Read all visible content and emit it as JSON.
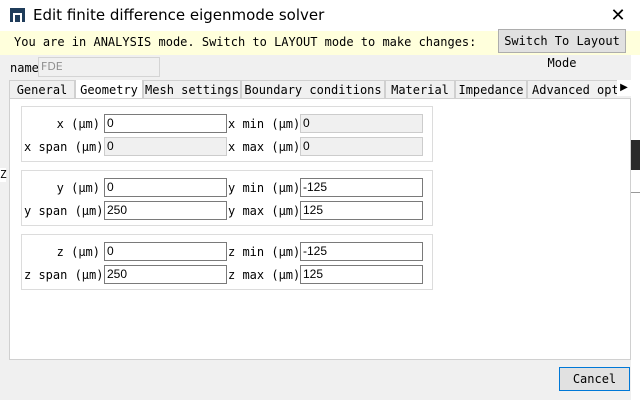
{
  "window": {
    "title": "Edit finite difference eigenmode solver",
    "close_glyph": "✕"
  },
  "banner": {
    "text": "You are in ANALYSIS mode.  Switch to LAYOUT mode to make changes:",
    "button_label": "Switch To Layout Mode"
  },
  "name": {
    "label": "name",
    "value": "FDE"
  },
  "tabs": [
    {
      "label": "General"
    },
    {
      "label": "Geometry",
      "active": true
    },
    {
      "label": "Mesh settings"
    },
    {
      "label": "Boundary conditions"
    },
    {
      "label": "Material"
    },
    {
      "label": "Impedance"
    },
    {
      "label": "Advanced options"
    }
  ],
  "tab_scroll_glyph": "▶",
  "geometry": {
    "x": {
      "center_label": "x (μm)",
      "center": "0",
      "span_label": "x span (μm)",
      "span": "0",
      "min_label": "x min (μm)",
      "min": "0",
      "max_label": "x max (μm)",
      "max": "0"
    },
    "y": {
      "center_label": "y (μm)",
      "center": "0",
      "span_label": "y span (μm)",
      "span": "250",
      "min_label": "y min (μm)",
      "min": "-125",
      "max_label": "y max (μm)",
      "max": "125"
    },
    "z": {
      "center_label": "z (μm)",
      "center": "0",
      "span_label": "z span (μm)",
      "span": "250",
      "min_label": "z min (μm)",
      "min": "-125",
      "max_label": "z max (μm)",
      "max": "125"
    }
  },
  "footer": {
    "cancel_label": "Cancel"
  },
  "background": {
    "left_fragment": "Z"
  }
}
